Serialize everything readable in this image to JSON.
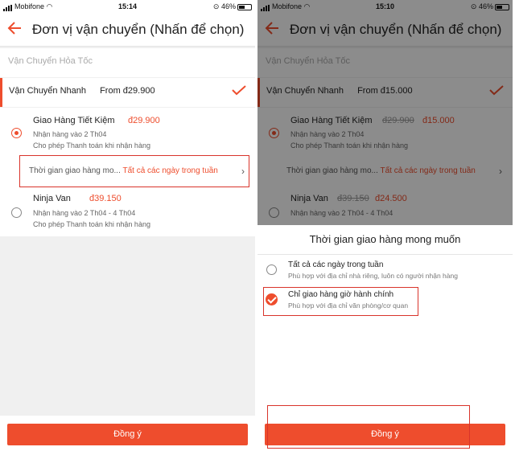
{
  "status": {
    "left": {
      "carrier": "Mobifone",
      "time": "15:14",
      "battery": "46%"
    },
    "right": {
      "carrier": "Mobifone",
      "time": "15:10",
      "battery": "46%"
    }
  },
  "header": {
    "title": "Đơn vị vận chuyển (Nhấn để chọn)"
  },
  "shipping": {
    "express": "Vận Chuyển Hỏa Tốc",
    "fast": "Vận Chuyển Nhanh",
    "fast_from_left": "From đ29.900",
    "fast_from_right": "From đ15.000"
  },
  "carriers": {
    "ghtk": {
      "name": "Giao Hàng Tiết Kiệm",
      "price_left": "đ29.900",
      "old_price_right": "đ29.900",
      "price_right": "đ15.000",
      "delivery": "Nhận hàng vào 2 Th04",
      "cod": "Cho phép Thanh toán khi nhận hàng"
    },
    "ninja": {
      "name": "Ninja Van",
      "price_left": "đ39.150",
      "old_price_right": "đ39.150",
      "price_right": "đ24.500",
      "delivery": "Nhận hàng vào 2 Th04 - 4 Th04",
      "cod": "Cho phép Thanh toán khi nhận hàng"
    }
  },
  "time_pref": {
    "label": "Thời gian giao hàng mo...",
    "value": "Tất cả các ngày trong tuần"
  },
  "sheet": {
    "title": "Thời gian giao hàng mong muốn",
    "options": [
      {
        "title": "Tất cả các ngày trong tuần",
        "sub": "Phù hợp với địa chỉ nhà riêng, luôn có người nhận hàng",
        "selected": false
      },
      {
        "title": "Chỉ giao hàng giờ hành chính",
        "sub": "Phù hợp với địa chỉ văn phòng/cơ quan",
        "selected": true
      }
    ]
  },
  "button": {
    "agree": "Đồng ý"
  },
  "colors": {
    "accent": "#ee4d2d",
    "highlight_box": "#d9342b"
  }
}
